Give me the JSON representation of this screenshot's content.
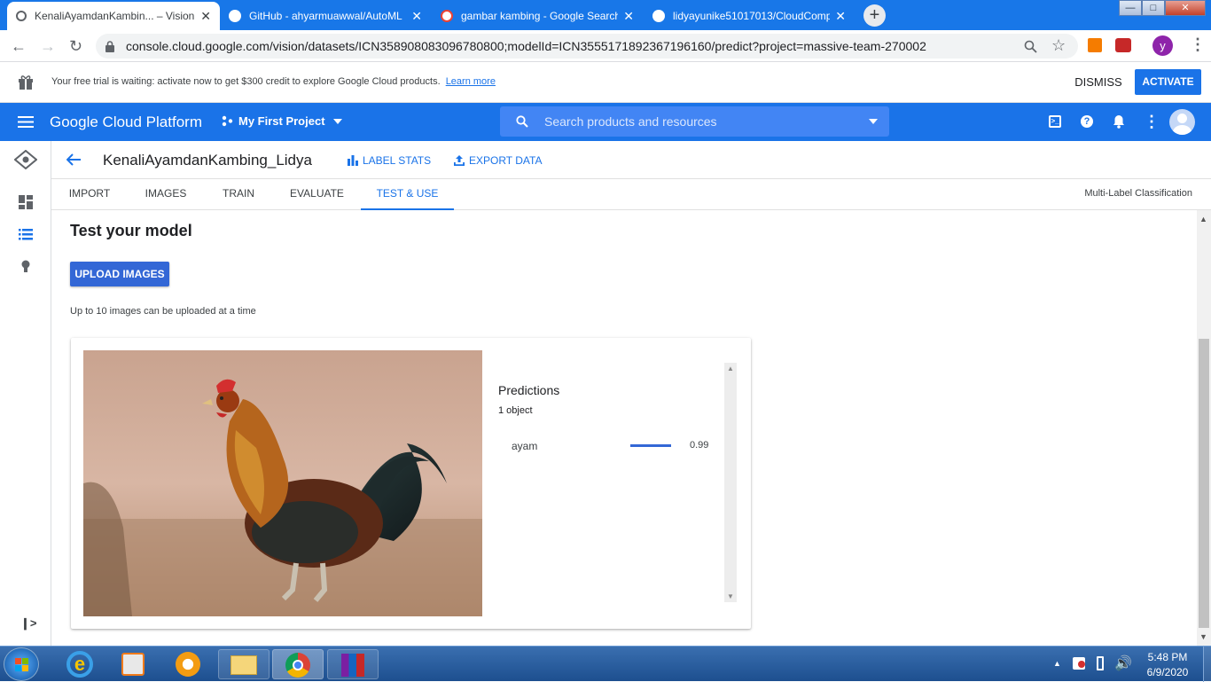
{
  "browser": {
    "tabs": [
      {
        "title": "KenaliAyamdanKambin... – Vision",
        "active": true,
        "icon": "gcp-favicon"
      },
      {
        "title": "GitHub - ahyarmuawwal/AutoML",
        "active": false,
        "icon": "github-icon"
      },
      {
        "title": "gambar kambing - Google Search",
        "active": false,
        "icon": "google-icon"
      },
      {
        "title": "lidyayunike51017013/CloudComp",
        "active": false,
        "icon": "github-icon"
      }
    ],
    "close_glyph": "✕",
    "new_tab_glyph": "+",
    "url": "console.cloud.google.com/vision/datasets/ICN358908083096780800;modelId=ICN3555171892367196160/predict?project=massive-team-270002",
    "profile_initial": "y"
  },
  "trial": {
    "text": "Your free trial is waiting: activate now to get $300 credit to explore Google Cloud products.",
    "learn_more": "Learn more",
    "dismiss": "DISMISS",
    "activate": "ACTIVATE"
  },
  "gcp": {
    "logo": "Google Cloud Platform",
    "project": "My First Project",
    "search_placeholder": "Search products and resources"
  },
  "dataset": {
    "title": "KenaliAyamdanKambing_Lidya",
    "label_stats": "LABEL STATS",
    "export_data": "EXPORT DATA"
  },
  "nav_tabs": [
    "IMPORT",
    "IMAGES",
    "TRAIN",
    "EVALUATE",
    "TEST & USE"
  ],
  "active_tab": "TEST & USE",
  "classification": "Multi-Label Classification",
  "test": {
    "heading": "Test your model",
    "upload": "UPLOAD IMAGES",
    "hint": "Up to 10 images can be uploaded at a time"
  },
  "predictions": {
    "title": "Predictions",
    "count": "1 object",
    "items": [
      {
        "label": "ayam",
        "score": "0.99",
        "fraction": 0.99
      }
    ]
  },
  "taskbar": {
    "time": "5:48 PM",
    "date": "6/9/2020"
  },
  "colors": {
    "accent": "#1a73e8",
    "chrome_tabstrip": "#1877e8",
    "taskbar": "#245a9e"
  }
}
